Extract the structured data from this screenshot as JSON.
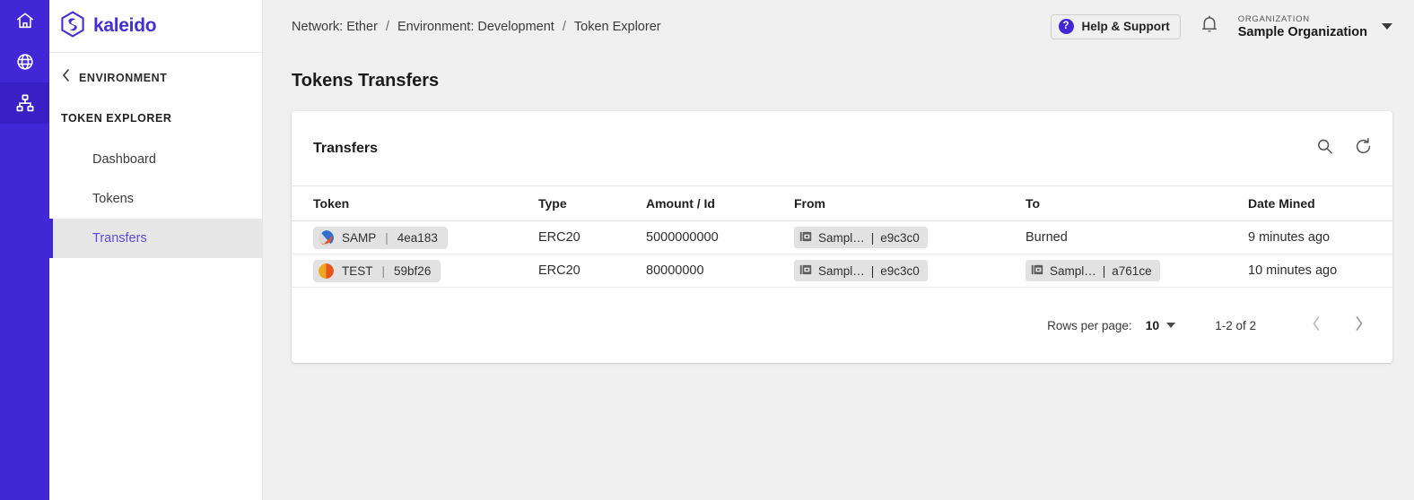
{
  "rail": {
    "items": [
      {
        "name": "home-icon",
        "label": "Home",
        "active": false
      },
      {
        "name": "globe-icon",
        "label": "Networks",
        "active": false
      },
      {
        "name": "sitemap-icon",
        "label": "Environments",
        "active": true
      }
    ]
  },
  "sidebar": {
    "logo_text": "kaleido",
    "back_label": "ENVIRONMENT",
    "section_label": "TOKEN EXPLORER",
    "items": [
      {
        "label": "Dashboard",
        "active": false
      },
      {
        "label": "Tokens",
        "active": false
      },
      {
        "label": "Transfers",
        "active": true
      }
    ]
  },
  "topbar": {
    "breadcrumb": [
      "Network: Ether",
      "Environment: Development",
      "Token Explorer"
    ],
    "breadcrumb_separator": "/",
    "help_label": "Help & Support",
    "help_icon_glyph": "?",
    "notifications_icon": "bell-icon",
    "org_label": "ORGANIZATION",
    "org_name": "Sample Organization"
  },
  "page": {
    "title": "Tokens Transfers"
  },
  "card": {
    "title": "Transfers",
    "search_icon": "search-icon",
    "refresh_icon": "refresh-icon",
    "columns": [
      "Token",
      "Type",
      "Amount / Id",
      "From",
      "To",
      "Date Mined"
    ],
    "rows": [
      {
        "token_symbol": "SAMP",
        "token_sep": "|",
        "token_id": "4ea183",
        "token_icon_colors": [
          "#2f6fd0",
          "#e8541f",
          "#d8d8d8"
        ],
        "type": "ERC20",
        "amount": "5000000000",
        "from": {
          "kind": "chip",
          "name": "Sampl…",
          "sep": "|",
          "addr": "e9c3c0"
        },
        "to": {
          "kind": "text",
          "text": "Burned"
        },
        "date_mined": "9 minutes ago"
      },
      {
        "token_symbol": "TEST",
        "token_sep": "|",
        "token_id": "59bf26",
        "token_icon_colors": [
          "#f0a51e",
          "#e8541f",
          "#dddddd"
        ],
        "type": "ERC20",
        "amount": "80000000",
        "from": {
          "kind": "chip",
          "name": "Sampl…",
          "sep": "|",
          "addr": "e9c3c0"
        },
        "to": {
          "kind": "chip",
          "name": "Sampl…",
          "sep": "|",
          "addr": "a761ce"
        },
        "date_mined": "10 minutes ago"
      }
    ],
    "footer": {
      "rows_per_page_label": "Rows per page:",
      "rows_per_page_value": "10",
      "range_label": "1-2 of 2",
      "prev_label": "Previous page",
      "next_label": "Next page"
    }
  },
  "colors": {
    "brand_purple": "#4127d6",
    "rail_active": "#3a20c4",
    "accent_link": "#5b4ae0",
    "page_bg": "#f0f0f0",
    "chip_bg": "#e2e2e2"
  }
}
